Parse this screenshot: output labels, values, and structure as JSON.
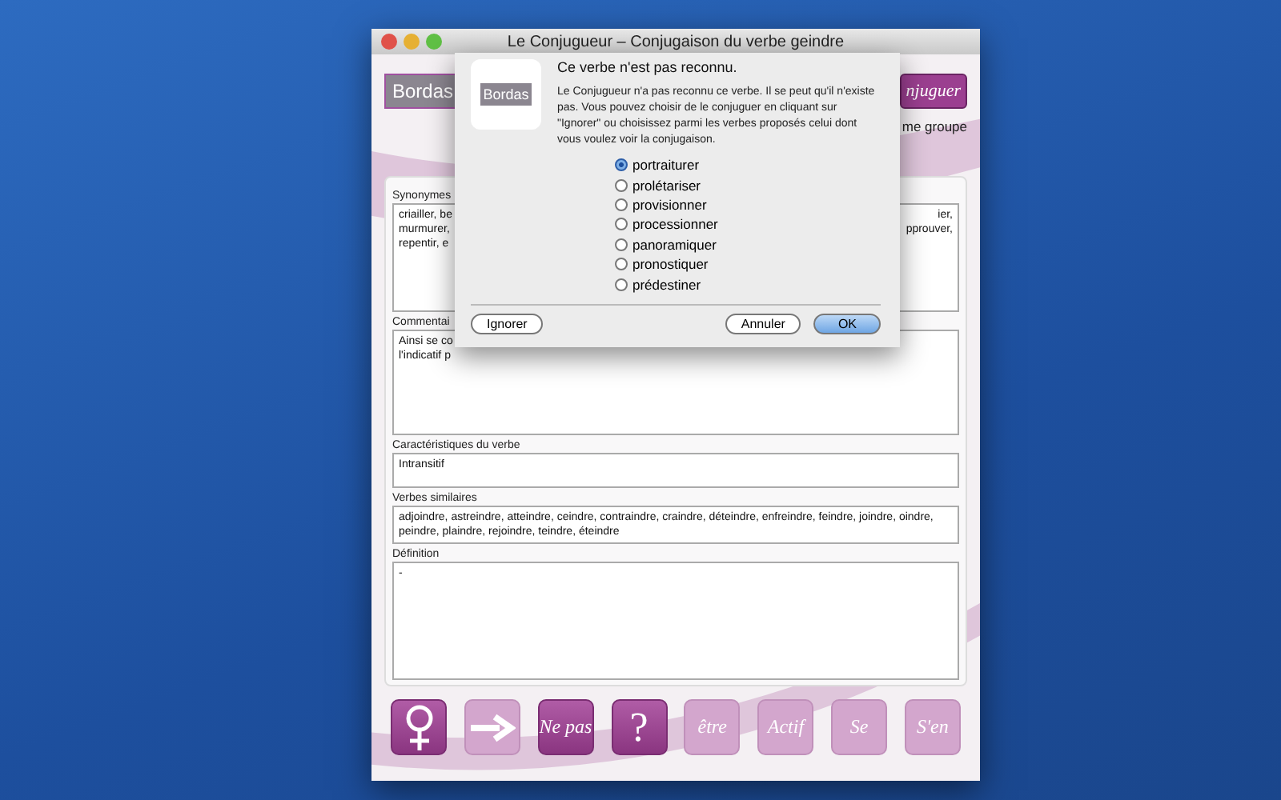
{
  "window": {
    "title": "Le Conjugueur – Conjugaison du verbe geindre"
  },
  "header": {
    "logo": "Bordas",
    "conjugate_button": "njuguer",
    "group_label": "me groupe"
  },
  "fields": [
    {
      "kind": "synonyms",
      "label": "Synonymes",
      "left_lines": [
        "criailler, be",
        "murmurer,",
        "repentir, e"
      ],
      "right_lines": [
        "ier,",
        "pprouver,"
      ]
    },
    {
      "kind": "comment",
      "label": "Commentai",
      "left_lines": [
        "Ainsi se co",
        "l'indicatif p"
      ]
    },
    {
      "kind": "plain",
      "label": "Caractéristiques du verbe",
      "value": "Intransitif"
    },
    {
      "kind": "plain",
      "label": "Verbes similaires",
      "value": "adjoindre, astreindre, atteindre, ceindre, contraindre, craindre, déteindre, enfreindre, feindre, joindre, oindre, peindre, plaindre, rejoindre, teindre, éteindre"
    },
    {
      "kind": "tall",
      "label": "Définition",
      "value": "-"
    }
  ],
  "toolbar": [
    {
      "kind": "female",
      "enabled": true
    },
    {
      "kind": "arrow",
      "enabled": false
    },
    {
      "kind": "text",
      "label": "Ne pas",
      "enabled": true
    },
    {
      "kind": "text",
      "label": "?",
      "enabled": true
    },
    {
      "kind": "text",
      "label": "être",
      "enabled": false
    },
    {
      "kind": "text",
      "label": "Actif",
      "enabled": false
    },
    {
      "kind": "text",
      "label": "Se",
      "enabled": false
    },
    {
      "kind": "text",
      "label": "S'en",
      "enabled": false
    }
  ],
  "dialog": {
    "logo": "Bordas",
    "title": "Ce verbe n'est pas reconnu.",
    "message": "Le Conjugueur n'a pas reconnu ce verbe. Il se peut qu'il n'existe pas. Vous pouvez choisir de le conjuguer en cliquant sur \"Ignorer\" ou choisissez parmi les verbes proposés celui dont vous voulez voir la conjugaison.",
    "options": [
      {
        "label": "portraiturer",
        "selected": true
      },
      {
        "label": "prolétariser",
        "selected": false
      },
      {
        "label": "provisionner",
        "selected": false
      },
      {
        "label": "processionner",
        "selected": false
      },
      {
        "label": "panoramiquer",
        "selected": false
      },
      {
        "label": "pronostiquer",
        "selected": false
      },
      {
        "label": "prédestiner",
        "selected": false
      }
    ],
    "buttons": [
      {
        "label": "Ignorer",
        "default": false
      },
      {
        "label": "Annuler",
        "default": false
      },
      {
        "label": "OK",
        "default": true
      }
    ]
  }
}
